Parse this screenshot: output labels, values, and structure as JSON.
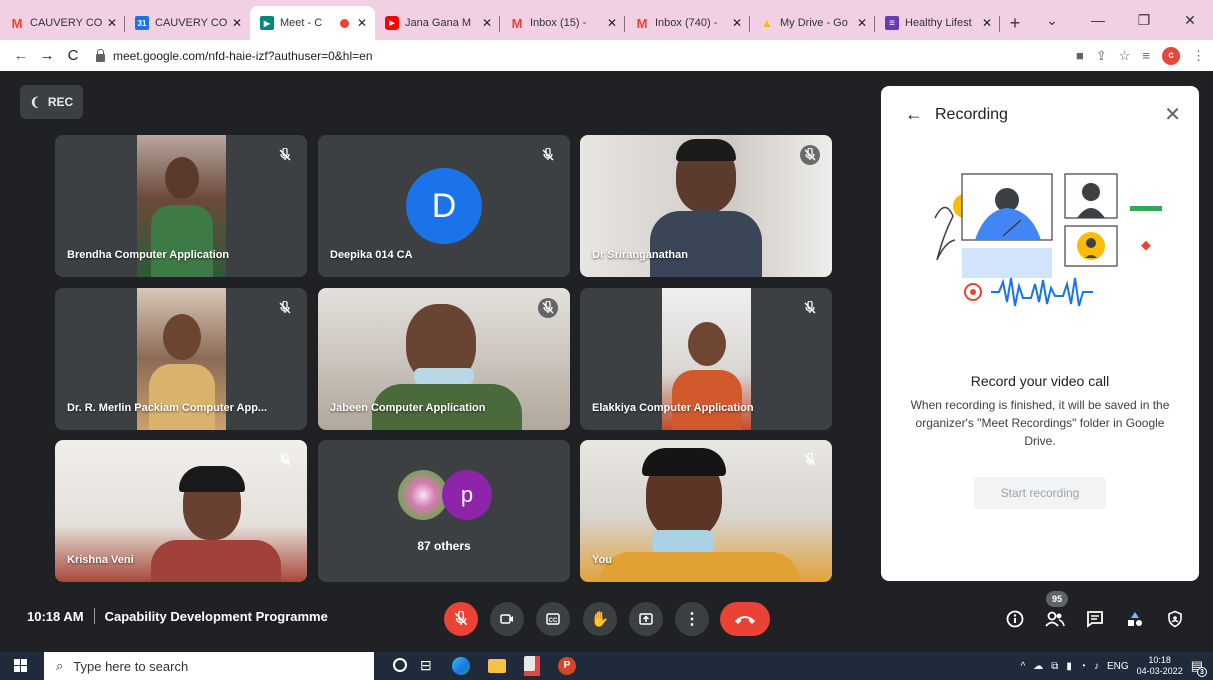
{
  "browser": {
    "tabs": [
      {
        "icon": "gmail-icon",
        "title": "CAUVERY CO",
        "color": "#ea4335",
        "glyph": "M"
      },
      {
        "icon": "calendar-icon",
        "title": "CAUVERY CO",
        "color": "#1a73e8",
        "glyph": "31"
      },
      {
        "icon": "meet-icon",
        "title": "Meet - C",
        "color": "#00897b",
        "glyph": "▶",
        "active": true
      },
      {
        "icon": "youtube-icon",
        "title": "Jana Gana M",
        "color": "#ff0000",
        "glyph": "▶"
      },
      {
        "icon": "gmail-icon",
        "title": "Inbox (15) -",
        "color": "#ea4335",
        "glyph": "M"
      },
      {
        "icon": "gmail-icon",
        "title": "Inbox (740) -",
        "color": "#ea4335",
        "glyph": "M"
      },
      {
        "icon": "drive-icon",
        "title": "My Drive - Go",
        "color": "#34a853",
        "glyph": "▲"
      },
      {
        "icon": "forms-icon",
        "title": "Healthy Lifest",
        "color": "#673ab7",
        "glyph": "≡"
      }
    ],
    "url": "meet.google.com/nfd-haie-izf?authuser=0&hl=en",
    "profile_initial": "c"
  },
  "meet": {
    "rec_label": "REC",
    "participants": [
      {
        "name": "Brendha Computer Application"
      },
      {
        "name": "Deepika 014 CA",
        "initial": "D"
      },
      {
        "name": "Dr Sriranganathan"
      },
      {
        "name": "Dr. R. Merlin Packiam Computer App..."
      },
      {
        "name": "Jabeen Computer Application"
      },
      {
        "name": "Elakkiya Computer Application"
      },
      {
        "name": "Krishna Veni"
      },
      {
        "name": "87 others",
        "initial": "p"
      },
      {
        "name": "You"
      }
    ],
    "time": "10:18 AM",
    "meeting_title": "Capability Development Programme",
    "people_count": "95"
  },
  "recording_panel": {
    "title": "Recording",
    "heading": "Record your video call",
    "description": "When recording is finished, it will be saved in the organizer's \"Meet Recordings\" folder in Google Drive.",
    "button": "Start recording"
  },
  "taskbar": {
    "search_placeholder": "Type here to search",
    "lang": "ENG",
    "time": "10:18",
    "date": "04-03-2022",
    "notif_count": "3"
  },
  "colors": {
    "meet_bg": "#202124",
    "tile_bg": "#3c4043",
    "hangup_red": "#ea4335",
    "avatar_blue": "#1a73e8",
    "avatar_purple": "#8e24aa",
    "tabstrip": "#f2d0e4"
  }
}
